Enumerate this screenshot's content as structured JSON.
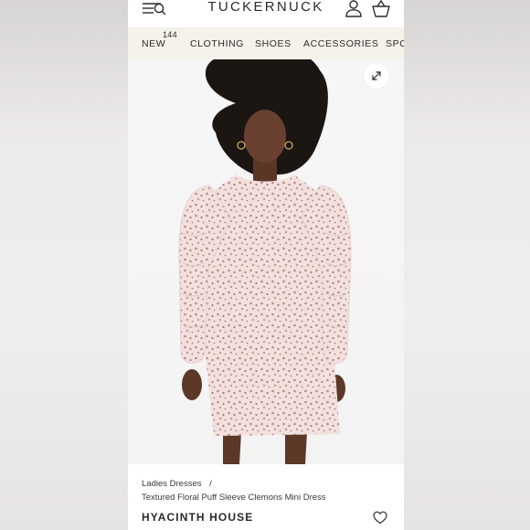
{
  "header": {
    "logo": "TUCKERNUCK",
    "icons": [
      "menu-search-icon",
      "user-icon",
      "shopping-bag-icon"
    ]
  },
  "nav": {
    "items": [
      {
        "label": "NEW",
        "badge": "144"
      },
      {
        "label": "CLOTHING"
      },
      {
        "label": "SHOES"
      },
      {
        "label": "ACCESSORIES"
      },
      {
        "label": "SPO"
      }
    ]
  },
  "product": {
    "breadcrumb": {
      "category": "Ladies Dresses",
      "separator": "/"
    },
    "name": "Textured Floral Puff Sleeve Clemons Mini Dress",
    "brand": "HYACINTH HOUSE",
    "image_alt_icon": "expand-icon",
    "wishlist_icon": "heart-icon"
  },
  "colors": {
    "nav_background": "#f5f2ea",
    "text": "#2a2a2a",
    "dress_base": "#f1dede",
    "dress_print": "#b98b84"
  }
}
